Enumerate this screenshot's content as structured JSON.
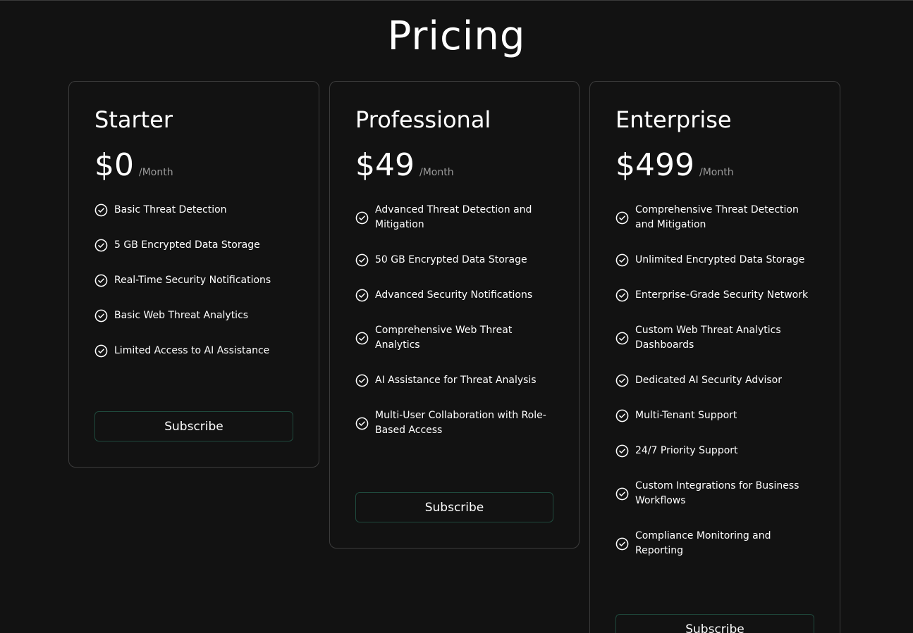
{
  "page": {
    "title": "Pricing"
  },
  "plans": [
    {
      "name": "Starter",
      "price": "$0",
      "period": "/Month",
      "features": [
        "Basic Threat Detection",
        "5 GB Encrypted Data Storage",
        "Real-Time Security Notifications",
        "Basic Web Threat Analytics",
        "Limited Access to AI Assistance"
      ],
      "button_label": "Subscribe"
    },
    {
      "name": "Professional",
      "price": "$49",
      "period": "/Month",
      "features": [
        "Advanced Threat Detection and Mitigation",
        "50 GB Encrypted Data Storage",
        "Advanced Security Notifications",
        "Comprehensive Web Threat Analytics",
        "AI Assistance for Threat Analysis",
        "Multi-User Collaboration with Role-Based Access"
      ],
      "button_label": "Subscribe"
    },
    {
      "name": "Enterprise",
      "price": "$499",
      "period": "/Month",
      "features": [
        "Comprehensive Threat Detection and Mitigation",
        "Unlimited Encrypted Data Storage",
        "Enterprise-Grade Security Network",
        "Custom Web Threat Analytics Dashboards",
        "Dedicated AI Security Advisor",
        "Multi-Tenant Support",
        "24/7 Priority Support",
        "Custom Integrations for Business Workflows",
        "Compliance Monitoring and Reporting"
      ],
      "button_label": "Subscribe"
    }
  ],
  "icons": {
    "feature": "check-circle-icon"
  },
  "colors": {
    "background": "#121212",
    "card_border": "#3c3c3c",
    "button_border": "#1f4a3d",
    "muted_text": "#9a9a9a"
  }
}
